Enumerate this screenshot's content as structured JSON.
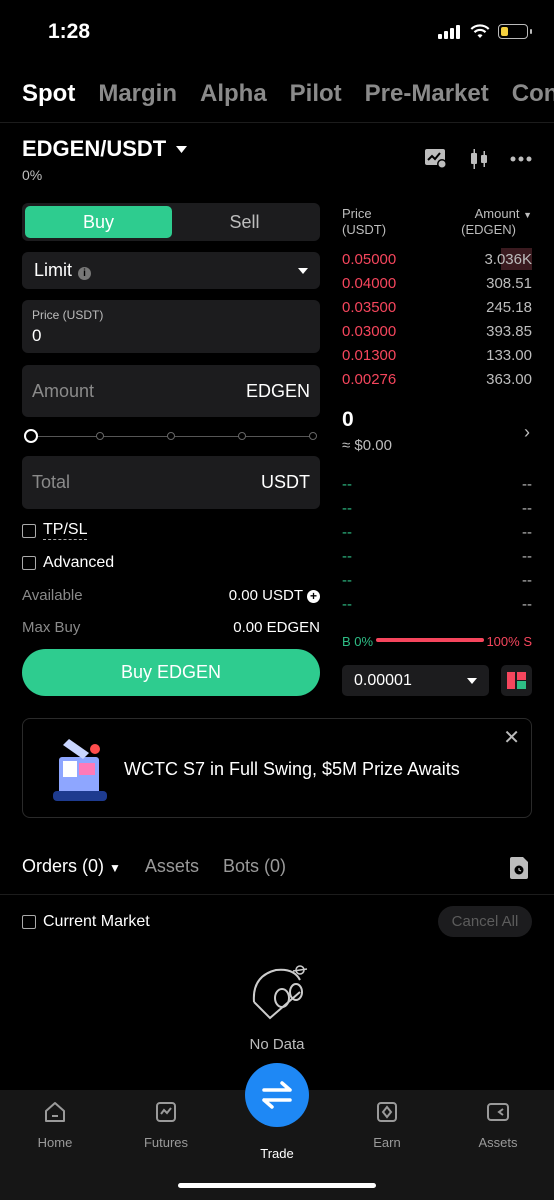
{
  "status": {
    "time": "1:28"
  },
  "top_tabs": [
    "Spot",
    "Margin",
    "Alpha",
    "Pilot",
    "Pre-Market",
    "Conv"
  ],
  "pair": {
    "name": "EDGEN/USDT",
    "change": "0%"
  },
  "order_form": {
    "buy": "Buy",
    "sell": "Sell",
    "order_type": "Limit",
    "price_label": "Price (USDT)",
    "price_value": "0",
    "amount_placeholder": "Amount",
    "amount_unit": "EDGEN",
    "total_placeholder": "Total",
    "total_unit": "USDT",
    "tpsl": "TP/SL",
    "advanced": "Advanced",
    "available_label": "Available",
    "available_value": "0.00 USDT",
    "max_buy_label": "Max Buy",
    "max_buy_value": "0.00 EDGEN",
    "buy_button": "Buy EDGEN"
  },
  "order_book": {
    "price_header": "Price",
    "price_unit": "(USDT)",
    "amount_header": "Amount",
    "amount_unit": "(EDGEN)",
    "asks": [
      {
        "price": "0.05000",
        "amount": "3.036K"
      },
      {
        "price": "0.04000",
        "amount": "308.51"
      },
      {
        "price": "0.03500",
        "amount": "245.18"
      },
      {
        "price": "0.03000",
        "amount": "393.85"
      },
      {
        "price": "0.01300",
        "amount": "133.00"
      },
      {
        "price": "0.00276",
        "amount": "363.00"
      }
    ],
    "mid_price": "0",
    "mid_usd": "≈ $0.00",
    "bids": [
      {
        "price": "--",
        "amount": "--"
      },
      {
        "price": "--",
        "amount": "--"
      },
      {
        "price": "--",
        "amount": "--"
      },
      {
        "price": "--",
        "amount": "--"
      },
      {
        "price": "--",
        "amount": "--"
      },
      {
        "price": "--",
        "amount": "--"
      }
    ],
    "buy_ratio": "B 0%",
    "sell_ratio": "100% S",
    "depth": "0.00001"
  },
  "banner": {
    "text": "WCTC S7 in Full Swing, $5M Prize Awaits"
  },
  "orders": {
    "tabs": [
      "Orders (0)",
      "Assets",
      "Bots (0)"
    ],
    "current_market": "Current Market",
    "cancel_all": "Cancel All",
    "no_data": "No Data"
  },
  "nav": [
    {
      "label": "Home",
      "icon": "home-icon"
    },
    {
      "label": "Futures",
      "icon": "futures-icon"
    },
    {
      "label": "Trade",
      "icon": "trade-icon"
    },
    {
      "label": "Earn",
      "icon": "earn-icon"
    },
    {
      "label": "Assets",
      "icon": "wallet-icon"
    }
  ],
  "colors": {
    "accent": "#2ecc8f",
    "ask": "#f6465d",
    "bid": "#2ebd85",
    "trade": "#1e88f5"
  }
}
